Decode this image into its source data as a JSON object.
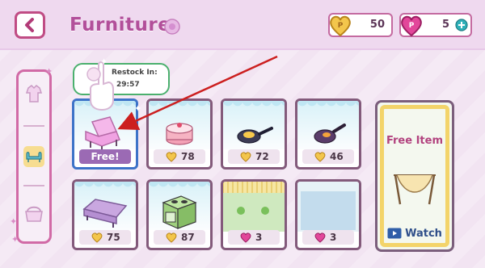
{
  "header": {
    "title": "Furniture",
    "coins": "50",
    "gems": "5"
  },
  "restock": {
    "label": "Restock In:",
    "time": "29:57"
  },
  "cards": [
    {
      "price": "Free!",
      "currency": "free"
    },
    {
      "price": "78",
      "currency": "coin"
    },
    {
      "price": "72",
      "currency": "coin"
    },
    {
      "price": "46",
      "currency": "coin"
    },
    {
      "price": "75",
      "currency": "coin"
    },
    {
      "price": "87",
      "currency": "coin"
    },
    {
      "price": "3",
      "currency": "gem"
    },
    {
      "price": "3",
      "currency": "gem"
    }
  ],
  "watch": {
    "title": "Free Item",
    "button": "Watch"
  },
  "colors": {
    "accent": "#b24f9a",
    "annotation_arrow": "#cc1f1f"
  }
}
